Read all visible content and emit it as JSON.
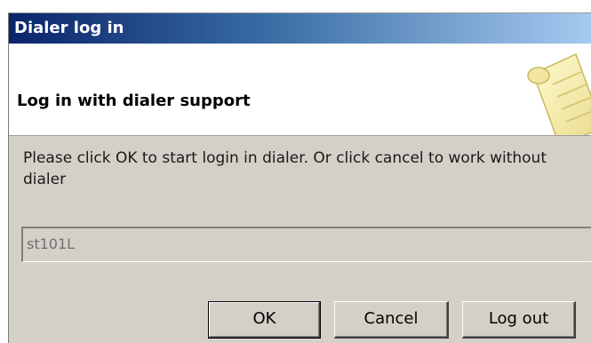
{
  "window": {
    "title": "Dialer log in"
  },
  "header": {
    "title": "Log in with dialer support",
    "icon": "scroll-icon"
  },
  "message": "Please click OK to start login in dialer. Or click cancel to work without dialer",
  "login_field": {
    "value": "st101L"
  },
  "buttons": {
    "ok": "OK",
    "cancel": "Cancel",
    "logout": "Log out"
  },
  "colors": {
    "title_start": "#0a246a",
    "title_end": "#a6caf0",
    "dialog_bg": "#d4d0c8"
  }
}
